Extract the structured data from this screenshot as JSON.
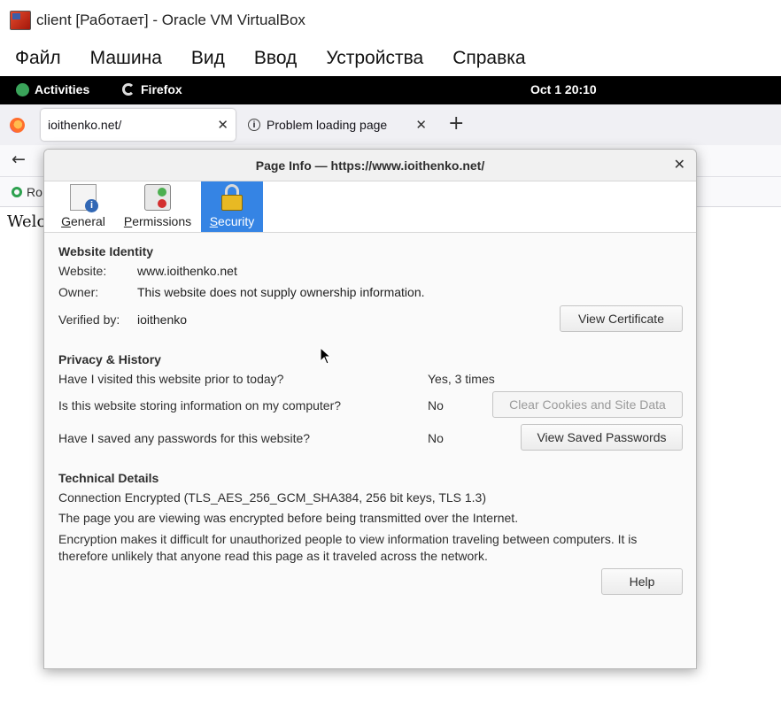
{
  "vbox": {
    "title": "client [Работает] - Oracle VM VirtualBox",
    "menu": [
      "Файл",
      "Машина",
      "Вид",
      "Ввод",
      "Устройства",
      "Справка"
    ]
  },
  "gnome": {
    "activities": "Activities",
    "app": "Firefox",
    "clock": "Oct 1  20:10"
  },
  "firefox": {
    "tabs": [
      {
        "label": "ioithenko.net/",
        "active": true
      },
      {
        "label": "Problem loading page",
        "active": false
      }
    ],
    "bookmark_partial": "Ro",
    "page_text_partial": "Welco"
  },
  "dialog": {
    "title": "Page Info — https://www.ioithenko.net/",
    "toolbar": [
      {
        "label": "General",
        "access_key": "G",
        "icon": "general-info-icon"
      },
      {
        "label": "Permissions",
        "access_key": "P",
        "icon": "permissions-icon"
      },
      {
        "label": "Security",
        "access_key": "S",
        "icon": "padlock-icon",
        "selected": true
      }
    ],
    "identity": {
      "heading": "Website Identity",
      "website_label": "Website:",
      "website_value": "www.ioithenko.net",
      "owner_label": "Owner:",
      "owner_value": "This website does not supply ownership information.",
      "verified_label": "Verified by:",
      "verified_value": "ioithenko",
      "view_cert_button": "View Certificate"
    },
    "privacy": {
      "heading": "Privacy & History",
      "visited_q": "Have I visited this website prior to today?",
      "visited_a": "Yes, 3 times",
      "storing_q": "Is this website storing information on my computer?",
      "storing_a": "No",
      "clear_button": "Clear Cookies and Site Data",
      "passwords_q": "Have I saved any passwords for this website?",
      "passwords_a": "No",
      "view_passwords_button": "View Saved Passwords"
    },
    "technical": {
      "heading": "Technical Details",
      "connection": "Connection Encrypted (TLS_AES_256_GCM_SHA384, 256 bit keys, TLS 1.3)",
      "line1": "The page you are viewing was encrypted before being transmitted over the Internet.",
      "line2": "Encryption makes it difficult for unauthorized people to view information traveling between computers. It is therefore unlikely that anyone read this page as it traveled across the network."
    },
    "help_button": "Help"
  },
  "colors": {
    "selected_tab_bg": "#3584e4",
    "gnome_bar": "#000000"
  }
}
